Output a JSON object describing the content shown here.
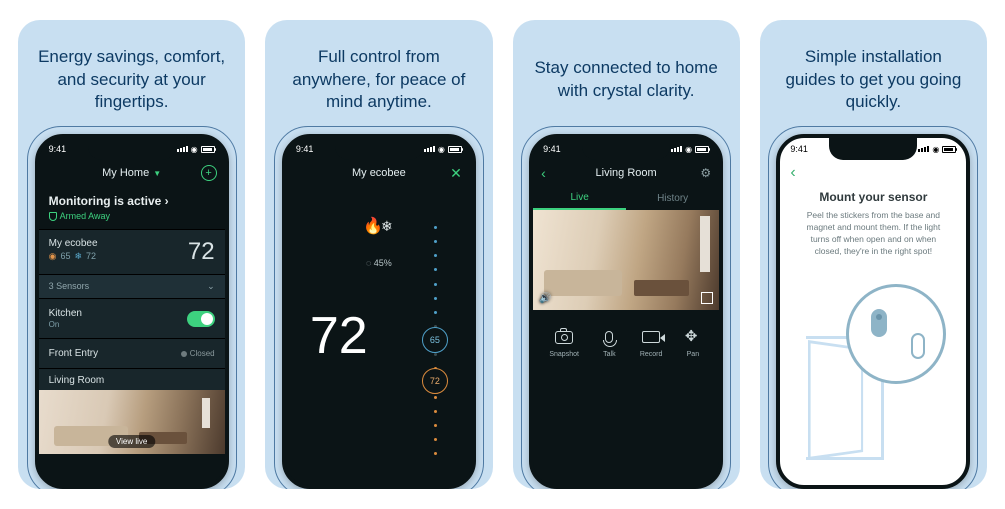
{
  "captions": [
    "Energy savings, comfort, and security at your fingertips.",
    "Full control from anywhere, for peace of mind anytime.",
    "Stay connected to home with crystal clarity.",
    "Simple installation guides to get you going quickly."
  ],
  "status_time": "9:41",
  "panel1": {
    "home_name": "My Home",
    "monitoring_title": "Monitoring is active ›",
    "armed_state": "Armed Away",
    "thermostat": {
      "name": "My ecobee",
      "hum": "65",
      "setpoint": "72",
      "current": "72"
    },
    "sensors_label": "3 Sensors",
    "kitchen": {
      "name": "Kitchen",
      "state": "On"
    },
    "front_entry": {
      "name": "Front Entry",
      "state": "Closed"
    },
    "living_room": "Living Room",
    "view_live": "View live"
  },
  "panel2": {
    "title": "My ecobee",
    "humidity": "45%",
    "temperature": "72",
    "cool_set": "65",
    "heat_set": "72"
  },
  "panel3": {
    "title": "Living Room",
    "tab_live": "Live",
    "tab_history": "History",
    "ctrl_snapshot": "Snapshot",
    "ctrl_talk": "Talk",
    "ctrl_record": "Record",
    "ctrl_pan": "Pan"
  },
  "panel4": {
    "title": "Mount your sensor",
    "description": "Peel the stickers from the base and magnet and mount them. If the light turns off when open and on when closed, they're in the right spot!"
  }
}
